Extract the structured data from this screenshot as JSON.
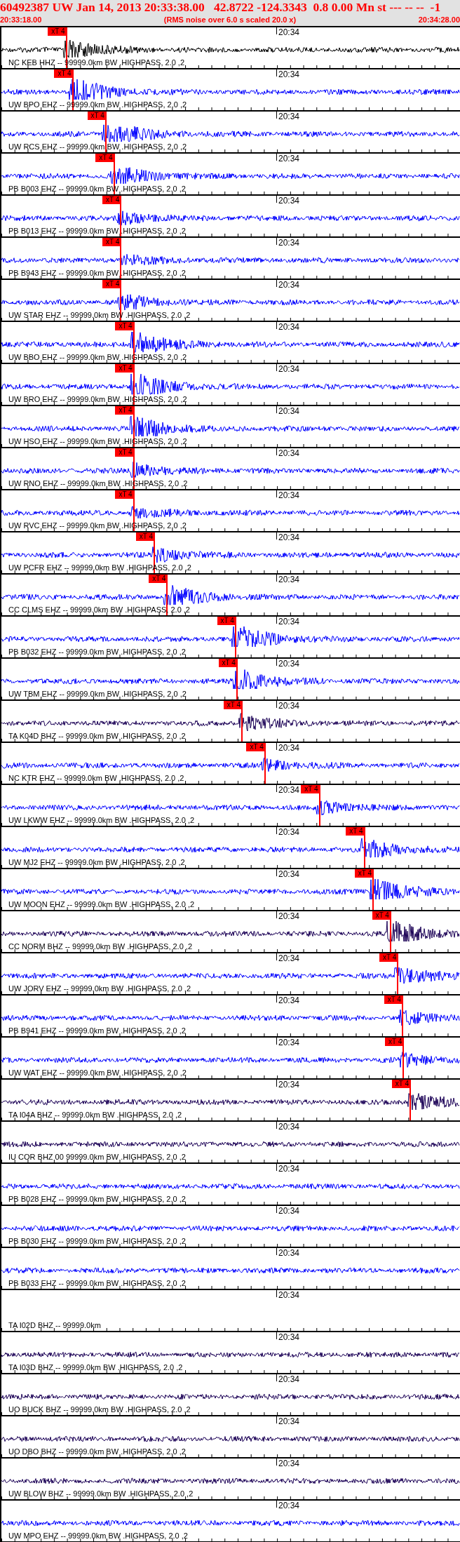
{
  "header": {
    "title": "60492387 UW Jan 14, 2013 20:33:38.00   42.8722 -124.3343  0.8 0.00 Mn st --- -- --  -1",
    "start_time": "20:33:18.00",
    "subtitle": "(RMS noise over 6.0 s scaled 20.0 x)",
    "end_time": "20:34:28.00"
  },
  "traces": [
    {
      "kind": "trace",
      "label": "NC KEB HHZ -- 99999.0km BW .HIGHPASS, 2.0 ,2",
      "time": "20:34",
      "color": "#000000",
      "pick": {
        "label": "xT 4",
        "level": 0.143
      }
    },
    {
      "kind": "trace",
      "label": "UW BPO EHZ -- 99999.0km BW .HIGHPASS, 2.0 ,2",
      "time": "20:34",
      "color": "#0000ff",
      "pick": {
        "label": "xT 4",
        "level": 0.157
      }
    },
    {
      "kind": "trace",
      "label": "UW RCS EHZ -- 99999.0km BW .HIGHPASS, 2.0 ,2",
      "time": "20:34",
      "color": "#0000ff",
      "pick": {
        "label": "xT 4",
        "level": 0.229
      }
    },
    {
      "kind": "trace",
      "label": "PB B003 EHZ -- 99999.0km BW .HIGHPASS, 2.0 ,2",
      "time": "20:34",
      "color": "#0000ff",
      "pick": {
        "label": "xT 4",
        "level": 0.247
      }
    },
    {
      "kind": "trace",
      "label": "PB B013 EHZ -- 99999.0km BW .HIGHPASS, 2.0 ,2",
      "time": "20:34",
      "color": "#0000ff",
      "pick": {
        "label": "xT 4",
        "level": 0.262
      }
    },
    {
      "kind": "trace",
      "label": "PB B943 EHZ -- 99999.0km BW .HIGHPASS, 2.0 ,2",
      "time": "20:34",
      "color": "#0000ff",
      "pick": {
        "label": "xT 4",
        "level": 0.262
      }
    },
    {
      "kind": "trace",
      "label": "UW STAR EHZ -- 99999.0km BW .HIGHPASS, 2.0 ,2",
      "time": "20:34",
      "color": "#0000ff",
      "pick": {
        "label": "xT 4",
        "level": 0.262
      }
    },
    {
      "kind": "trace",
      "label": "UW BBO EHZ -- 99999.0km BW .HIGHPASS, 2.0 ,2",
      "time": "20:34",
      "color": "#0000ff",
      "pick": {
        "label": "xT 4",
        "level": 0.29
      }
    },
    {
      "kind": "trace",
      "label": "UW BRO EHZ -- 99999.0km BW .HIGHPASS, 2.0 ,2",
      "time": "20:34",
      "color": "#0000ff",
      "pick": {
        "label": "xT 4",
        "level": 0.29
      }
    },
    {
      "kind": "trace",
      "label": "UW HSO EHZ -- 99999.0km BW .HIGHPASS, 2.0 ,2",
      "time": "20:34",
      "color": "#0000ff",
      "pick": {
        "label": "xT 4",
        "level": 0.29
      }
    },
    {
      "kind": "trace",
      "label": "UW RNO EHZ -- 99999.0km BW .HIGHPASS, 2.0 ,2",
      "time": "20:34",
      "color": "#0000ff",
      "pick": {
        "label": "xT 4",
        "level": 0.29
      }
    },
    {
      "kind": "trace",
      "label": "UW RVC EHZ -- 99999.0km BW .HIGHPASS, 2.0 ,2",
      "time": "20:34",
      "color": "#0000ff",
      "pick": {
        "label": "xT 4",
        "level": 0.29
      }
    },
    {
      "kind": "trace",
      "label": "UW PCFR EHZ -- 99999.0km BW .HIGHPASS, 2.0 ,2",
      "time": "20:34",
      "color": "#0000ff",
      "pick": {
        "label": "xT 4",
        "level": 0.335
      }
    },
    {
      "kind": "trace",
      "label": "CC CLMS EHZ -- 99999.0km BW .HIGHPASS, 2.0 ,2",
      "time": "20:34",
      "color": "#0000ff",
      "pick": {
        "label": "xT 4",
        "level": 0.363
      }
    },
    {
      "kind": "trace",
      "label": "PB B032 EHZ -- 99999.0km BW .HIGHPASS, 2.0 ,2",
      "time": "20:34",
      "color": "#0000ff",
      "pick": {
        "label": "xT 4",
        "level": 0.512
      }
    },
    {
      "kind": "trace",
      "label": "UW TBM EHZ -- 99999.0km BW .HIGHPASS, 2.0 ,2",
      "time": "20:34",
      "color": "#0000ff",
      "pick": {
        "label": "xT 4",
        "level": 0.515
      }
    },
    {
      "kind": "trace",
      "label": "TA K04D BHZ -- 99999.0km BW .HIGHPASS, 2.0 ,2",
      "time": "20:34",
      "color": "#1a0055",
      "pick": {
        "label": "xT 4",
        "level": 0.526
      }
    },
    {
      "kind": "trace",
      "label": "NC KTR EHZ -- 99999.0km BW .HIGHPASS, 2.0 ,2",
      "time": "20:34",
      "color": "#0000ff",
      "pick": {
        "label": "xT 4",
        "level": 0.576
      }
    },
    {
      "kind": "trace",
      "label": "UW LKWW EHZ -- 99999.0km BW .HIGHPASS, 2.0 ,2",
      "time": "20:34",
      "color": "#0000ff",
      "pick": {
        "label": "xT 4",
        "level": 0.695
      }
    },
    {
      "kind": "trace",
      "label": "UW MJ2 EHZ -- 99999.0km BW .HIGHPASS, 2.0 ,2",
      "time": "20:34",
      "color": "#0000ff",
      "pick": {
        "label": "xT 4",
        "level": 0.793
      }
    },
    {
      "kind": "trace",
      "label": "UW MOON EHZ -- 99999.0km BW .HIGHPASS, 2.0 ,2",
      "time": "20:34",
      "color": "#0000ff",
      "pick": {
        "label": "xT 4",
        "level": 0.812
      }
    },
    {
      "kind": "trace",
      "label": "CC NORM BHZ -- 99999.0km BW .HIGHPASS, 2.0 ,2",
      "time": "20:34",
      "color": "#1a0055",
      "pick": {
        "label": "xT 4",
        "level": 0.85
      }
    },
    {
      "kind": "trace",
      "label": "UW JORV EHZ -- 99999.0km BW .HIGHPASS, 2.0 ,2",
      "time": "20:34",
      "color": "#0000ff",
      "pick": {
        "label": "xT 4",
        "level": 0.866
      }
    },
    {
      "kind": "trace",
      "label": "PB B941 EHZ -- 99999.0km BW .HIGHPASS, 2.0 ,2",
      "time": "20:34",
      "color": "#0000ff",
      "pick": {
        "label": "xT 4",
        "level": 0.876
      }
    },
    {
      "kind": "trace",
      "label": "UW WAT EHZ -- 99999.0km BW .HIGHPASS, 2.0 ,2",
      "time": "20:34",
      "color": "#0000ff",
      "pick": {
        "label": "xT 4",
        "level": 0.878
      }
    },
    {
      "kind": "trace",
      "label": "TA I04A BHZ -- 99999.0km BW .HIGHPASS, 2.0 ,2",
      "time": "20:34",
      "color": "#1a0055",
      "pick": {
        "label": "xT 4",
        "level": 0.893
      }
    },
    {
      "kind": "trace",
      "label": "IU COR BHZ 00 99999.0km BW .HIGHPASS, 2.0 ,2",
      "time": "20:34",
      "color": "#1a0055"
    },
    {
      "kind": "trace",
      "label": "PB B028 EHZ -- 99999.0km BW .HIGHPASS, 2.0 ,2",
      "time": "20:34",
      "color": "#0000ff"
    },
    {
      "kind": "trace",
      "label": "PB B030 EHZ -- 99999.0km BW .HIGHPASS, 2.0 ,2",
      "time": "20:34",
      "color": "#0000ff"
    },
    {
      "kind": "trace",
      "label": "PB B033 EHZ -- 99999.0km BW .HIGHPASS, 2.0 ,2",
      "time": "20:34",
      "color": "#0000ff"
    },
    {
      "kind": "empty",
      "label": "TA I02D BHZ -- 99999.0km",
      "time": "20:34"
    },
    {
      "kind": "trace",
      "label": "TA I03D BHZ -- 99999.0km BW .HIGHPASS, 2.0 ,2",
      "time": "20:34",
      "color": "#1a0055"
    },
    {
      "kind": "trace",
      "label": "UO BUCK BHZ -- 99999.0km BW .HIGHPASS, 2.0 ,2",
      "time": "20:34",
      "color": "#1a0055"
    },
    {
      "kind": "trace",
      "label": "UO DBO BHZ -- 99999.0km BW .HIGHPASS, 2.0 ,2",
      "time": "20:34",
      "color": "#1a0055"
    },
    {
      "kind": "trace",
      "label": "UW BLOW BHZ -- 99999.0km BW .HIGHPASS, 2.0 ,2",
      "time": "20:34",
      "color": "#1a0055"
    },
    {
      "kind": "trace",
      "label": "UW MPO EHZ -- 99999.0km BW .HIGHPASS, 2.0 ,2",
      "time": "20:34",
      "color": "#0000ff"
    }
  ]
}
